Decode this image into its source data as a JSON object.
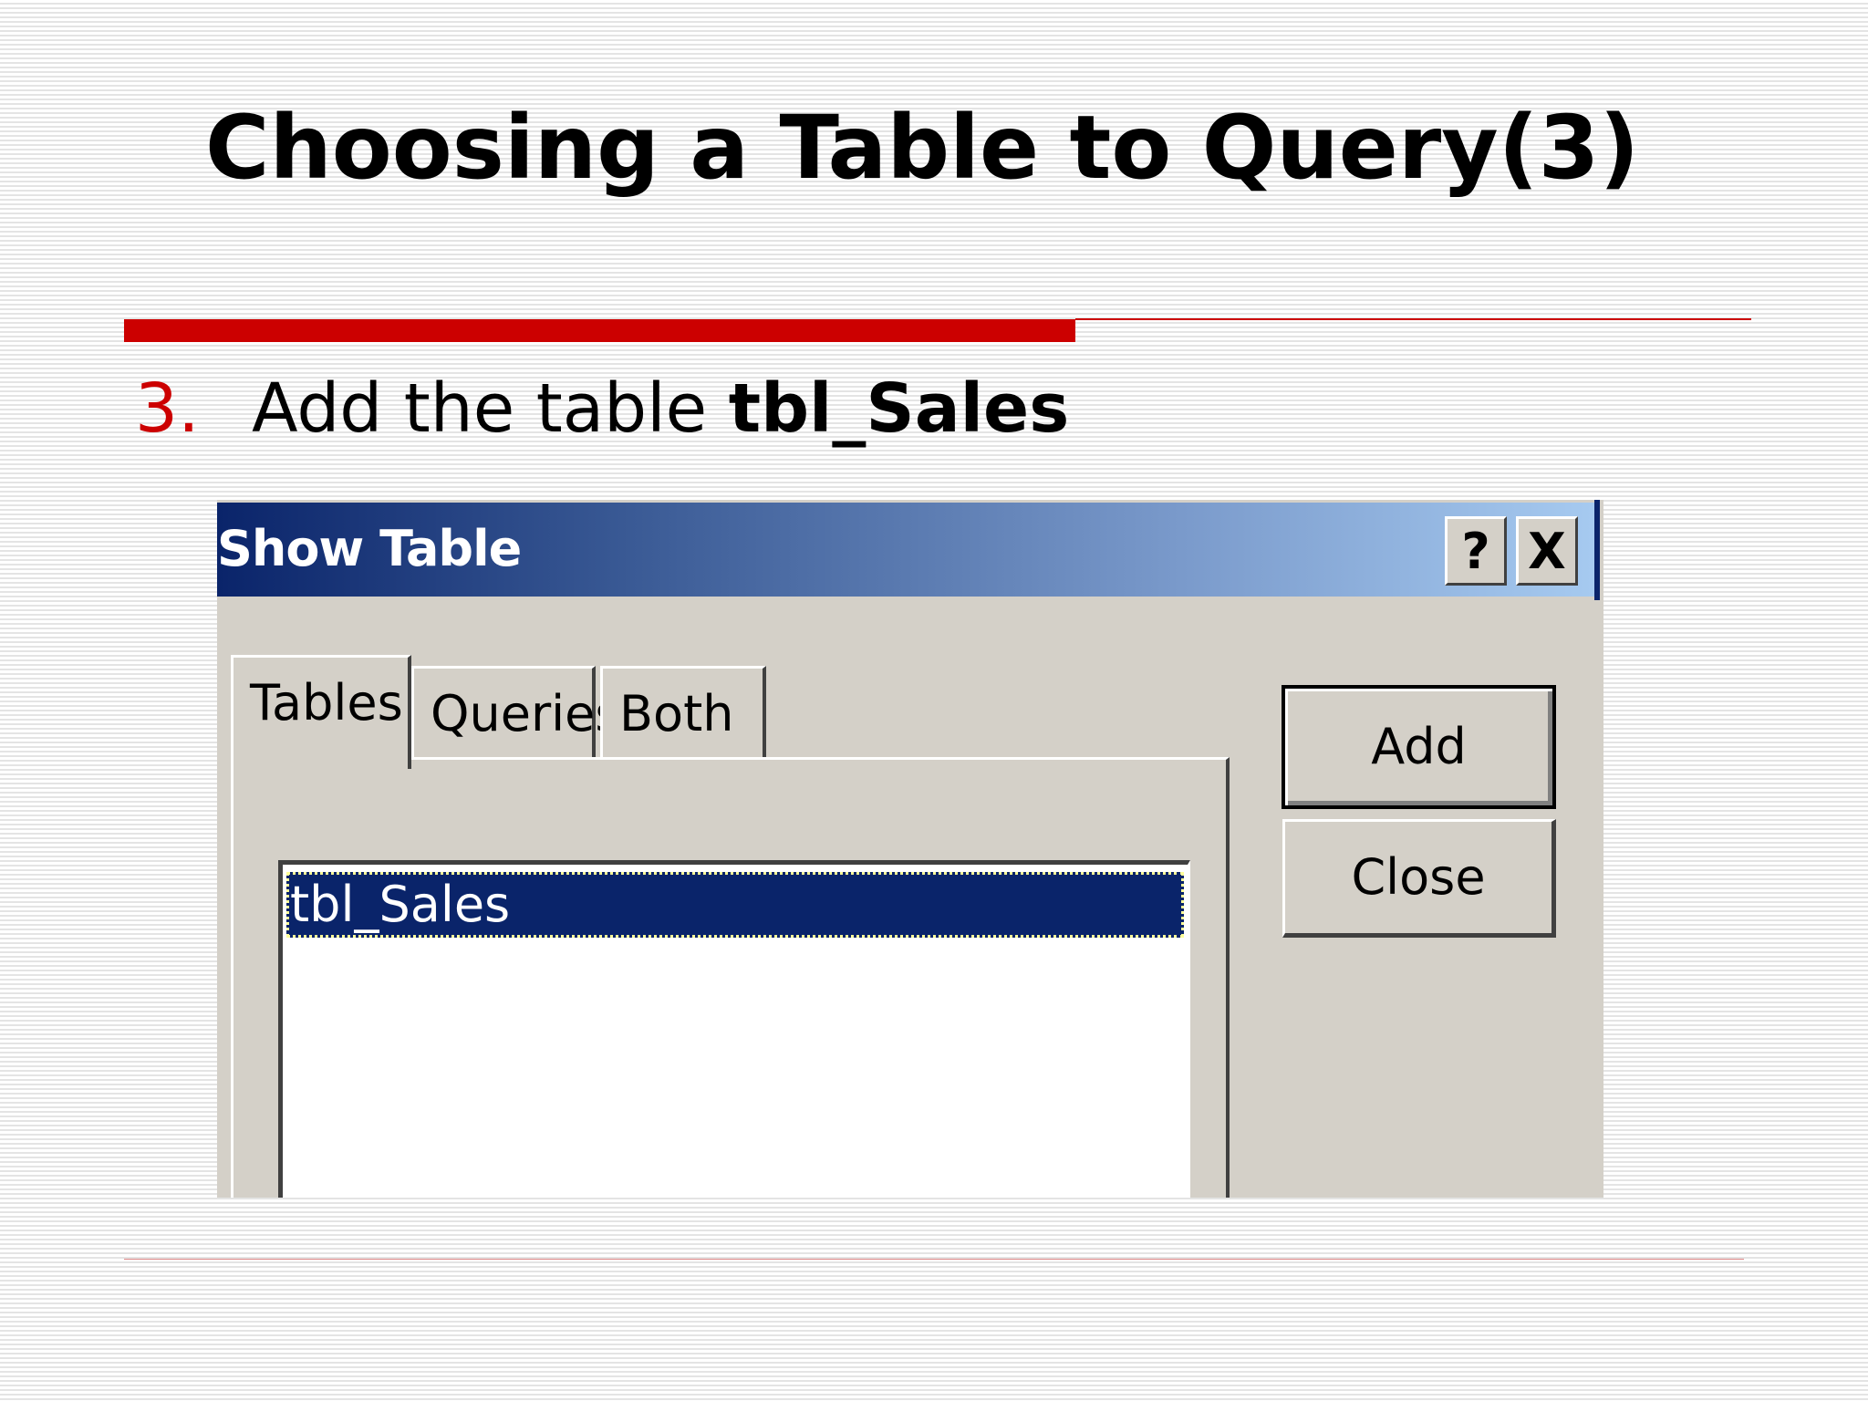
{
  "slide": {
    "title": "Choosing a Table to Query(3)",
    "bullet": {
      "number": "3.",
      "text": "Add the table ",
      "emphasis": "tbl_Sales"
    },
    "colors": {
      "accent": "#cc0000",
      "titlebar_start": "#0a246a",
      "titlebar_end": "#a6caf0",
      "selection": "#0a246a",
      "dialog_face": "#d4d0c8"
    }
  },
  "dialog": {
    "title": "Show Table",
    "help_button": "?",
    "close_button": "X",
    "tabs": [
      "Tables",
      "Queries",
      "Both"
    ],
    "selected_tab": "Tables",
    "list_items": [
      "tbl_Sales"
    ],
    "selected_item": "tbl_Sales",
    "buttons": {
      "add": "Add",
      "close": "Close"
    }
  }
}
